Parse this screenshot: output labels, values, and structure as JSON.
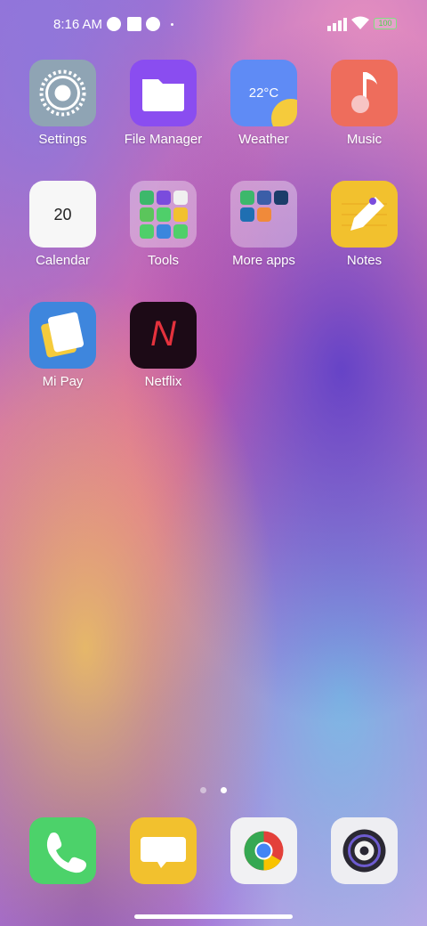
{
  "status_bar": {
    "time": "8:16 AM",
    "battery": "100",
    "icons": [
      "notification-icon",
      "square-icon",
      "notification-icon",
      "signal-icon",
      "wifi-icon",
      "battery-icon"
    ]
  },
  "apps": [
    {
      "label": "Settings",
      "icon": "gear-icon"
    },
    {
      "label": "File Manager",
      "icon": "folder-icon"
    },
    {
      "label": "Weather",
      "icon": "weather-icon",
      "temp": "22°C"
    },
    {
      "label": "Music",
      "icon": "music-note-icon"
    },
    {
      "label": "Calendar",
      "icon": "calendar-icon",
      "day": "20"
    },
    {
      "label": "Tools",
      "icon": "folder-icon"
    },
    {
      "label": "More apps",
      "icon": "folder-icon"
    },
    {
      "label": "Notes",
      "icon": "pencil-icon"
    },
    {
      "label": "Mi Pay",
      "icon": "wallet-icon"
    },
    {
      "label": "Netflix",
      "icon": "netflix-icon",
      "letter": "N"
    }
  ],
  "page_indicator": {
    "pages": 2,
    "current": 2
  },
  "dock": [
    {
      "icon": "phone-icon"
    },
    {
      "icon": "messages-icon"
    },
    {
      "icon": "chrome-icon"
    },
    {
      "icon": "camera-icon"
    }
  ],
  "colors": {
    "settings": "#8fa4b4",
    "file_manager": "#8a4df0",
    "weather": "#5f8bf5",
    "music": "#ee6d5c",
    "calendar": "#f7f7f7",
    "notes": "#f2c12e",
    "mipay": "#3e86dd",
    "netflix": "#1c0a16",
    "phone": "#4cd26a",
    "messages": "#f2c12e",
    "chrome_bg": "#f1f1f3",
    "camera_bg": "#eeeef2"
  }
}
